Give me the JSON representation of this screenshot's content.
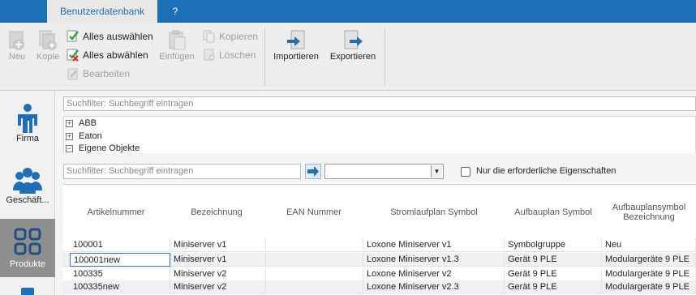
{
  "tabs": {
    "active": "Benutzerdatenbank",
    "help": "?"
  },
  "ribbon": {
    "neu": "Neu",
    "kopie": "Kopie",
    "alles_auswaehlen": "Alles auswählen",
    "alles_abwaehlen": "Alles abwählen",
    "bearbeiten": "Bearbeiten",
    "einfuegen": "Einfügen",
    "kopieren": "Kopieren",
    "loeschen": "Löschen",
    "importieren": "Importieren",
    "exportieren": "Exportieren"
  },
  "nav": {
    "firma": "Firma",
    "geschaeft": "Geschäft...",
    "produkte": "Produkte"
  },
  "tree": {
    "placeholder": "Suchfilter: Suchbegriff eintragen",
    "nodes": [
      {
        "label": "ABB",
        "state": "+"
      },
      {
        "label": "Eaton",
        "state": "+"
      },
      {
        "label": "Eigene Objekte",
        "state": "-"
      }
    ]
  },
  "filter": {
    "placeholder": "Suchfilter: Suchbegriff eintragen",
    "combo_value": "",
    "checkbox_label": "Nur die erforderliche Eigenschaften",
    "checkbox_checked": false
  },
  "table": {
    "columns": [
      "Artikelnummer",
      "Bezeichnung",
      "EAN Nummer",
      "Stromlaufplan Symbol",
      "Aufbauplan Symbol",
      "Aufbauplansymbol Bezeichnung"
    ],
    "rows": [
      [
        "100001",
        "Miniserver v1",
        "",
        "Loxone Miniserver v1",
        "Symbolgruppe",
        "Neu"
      ],
      [
        "100001new",
        "Miniserver v1",
        "",
        "Loxone Miniserver v1.3",
        "Gerät 9 PLE",
        "Modulargeräte 9 PLE"
      ],
      [
        "100335",
        "Miniserver v2",
        "",
        "Loxone Miniserver v2",
        "Gerät 9 PLE",
        "Modulargeräte 9 PLE"
      ],
      [
        "100335new",
        "Miniserver v2",
        "",
        "Loxone Miniserver v2.3",
        "Gerät 9 PLE",
        "Modulargeräte 9 PLE"
      ]
    ]
  },
  "colors": {
    "tabbar": "#1b6fb5",
    "accent_icon": "#1d6fb8",
    "nav_active": "#8f8f8f"
  }
}
